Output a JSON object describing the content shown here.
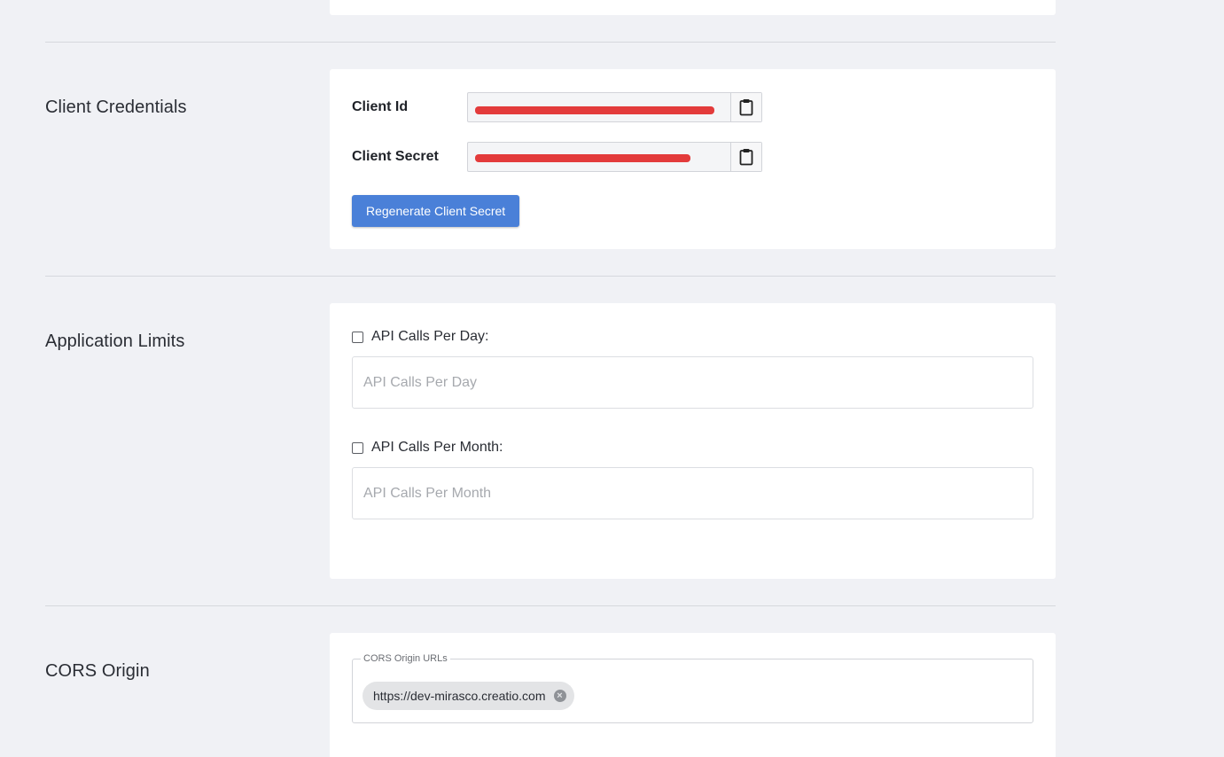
{
  "client_credentials": {
    "title": "Client Credentials",
    "client_id_label": "Client Id",
    "client_secret_label": "Client Secret",
    "regenerate_label": "Regenerate Client Secret"
  },
  "application_limits": {
    "title": "Application Limits",
    "per_day_label": "API Calls Per Day:",
    "per_day_placeholder": "API Calls Per Day",
    "per_month_label": "API Calls Per Month:",
    "per_month_placeholder": "API Calls Per Month"
  },
  "cors": {
    "title": "CORS Origin",
    "field_legend": "CORS Origin URLs",
    "chips": [
      "https://dev-mirasco.creatio.com"
    ]
  },
  "colors": {
    "primary_button": "#4a80d8",
    "redaction": "#e33b3b",
    "background": "#f0f1f5"
  },
  "icons": {
    "copy": "clipboard-icon",
    "chip_remove": "close-circle-icon"
  }
}
